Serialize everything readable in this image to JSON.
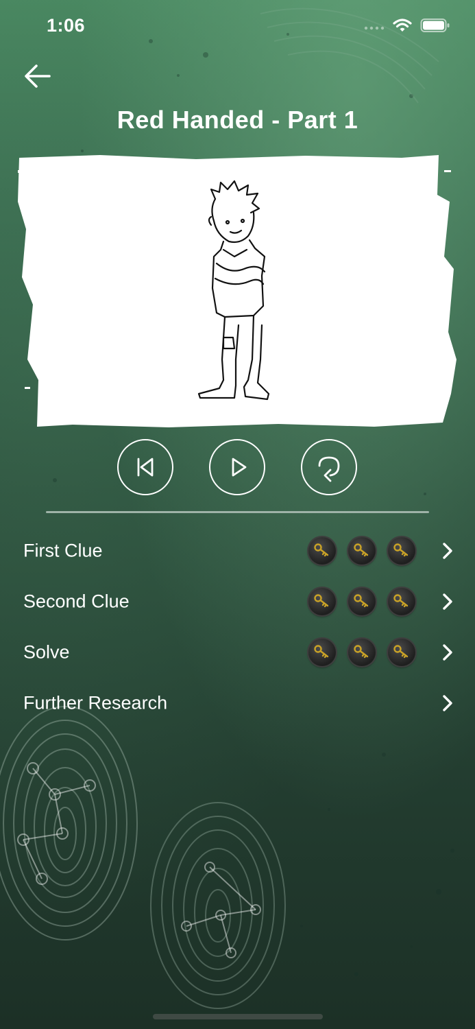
{
  "status_bar": {
    "time": "1:06"
  },
  "header": {
    "title": "Red Handed - Part 1"
  },
  "menu": {
    "items": [
      {
        "label": "First Clue"
      },
      {
        "label": "Second Clue"
      },
      {
        "label": "Solve"
      },
      {
        "label": "Further Research"
      }
    ]
  },
  "icons": {
    "back": "arrow-left-icon",
    "restart": "skip-back-icon",
    "play": "play-icon",
    "replay": "replay-icon",
    "key": "key-icon",
    "chevron": "chevron-right-icon"
  },
  "colors": {
    "accent_gold": "#c9a227",
    "bg_top": "#4a8a62",
    "bg_bottom": "#1c3026"
  }
}
